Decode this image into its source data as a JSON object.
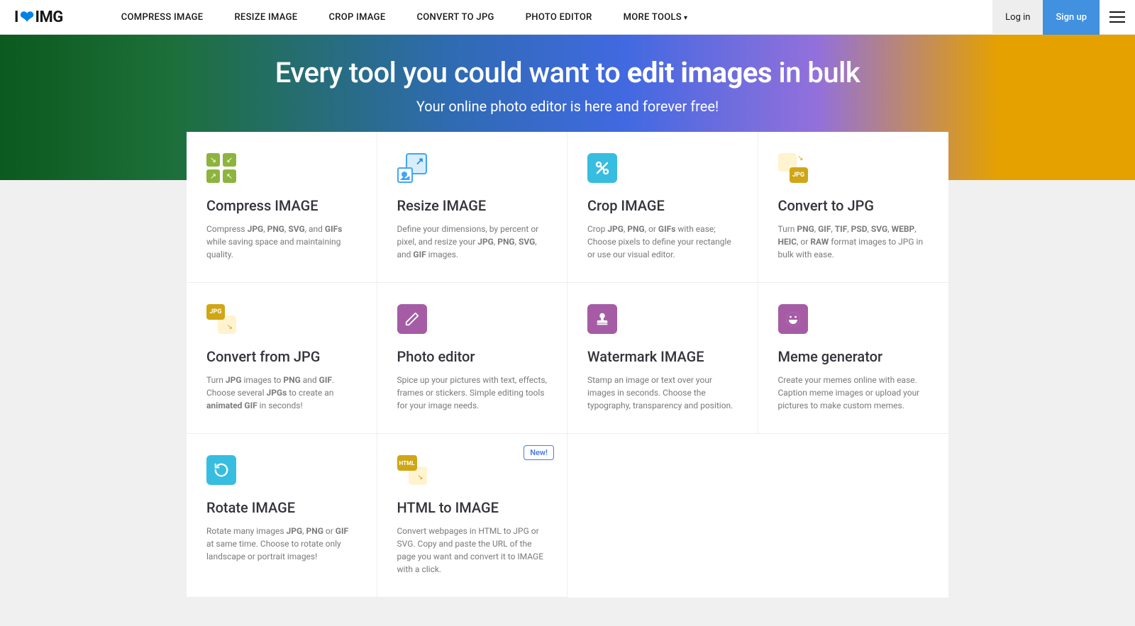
{
  "logo": {
    "prefix": "I",
    "suffix": "IMG"
  },
  "nav": {
    "items": [
      "COMPRESS IMAGE",
      "RESIZE IMAGE",
      "CROP IMAGE",
      "CONVERT TO JPG",
      "PHOTO EDITOR",
      "MORE TOOLS"
    ],
    "chevron": "▾"
  },
  "actions": {
    "login": "Log in",
    "signup": "Sign up"
  },
  "hero": {
    "title_pre": "Every tool you could want to ",
    "title_strong": "edit images",
    "title_post": " in bulk",
    "subtitle": "Your online photo editor is here and forever free!"
  },
  "badges": {
    "new": "New!"
  },
  "icons": {
    "jpg_label": "JPG",
    "html_label": "HTML"
  },
  "tools": [
    {
      "key": "compress",
      "title": "Compress IMAGE",
      "desc": "Compress <b>JPG</b>, <b>PNG</b>, <b>SVG</b>, and <b>GIFs</b> while saving space and maintaining quality."
    },
    {
      "key": "resize",
      "title": "Resize IMAGE",
      "desc": "Define your dimensions, by percent or pixel, and resize your <b>JPG</b>, <b>PNG</b>, <b>SVG</b>, and <b>GIF</b> images."
    },
    {
      "key": "crop",
      "title": "Crop IMAGE",
      "desc": "Crop <b>JPG</b>, <b>PNG</b>, or <b>GIFs</b> with ease; Choose pixels to define your rectangle or use our visual editor."
    },
    {
      "key": "tojpg",
      "title": "Convert to JPG",
      "desc": "Turn <b>PNG</b>, <b>GIF</b>, <b>TIF</b>, <b>PSD</b>, <b>SVG</b>, <b>WEBP</b>, <b>HEIC</b>, or <b>RAW</b> format images to JPG in bulk with ease."
    },
    {
      "key": "fromjpg",
      "title": "Convert from JPG",
      "desc": "Turn <b>JPG</b> images to <b>PNG</b> and <b>GIF</b>. Choose several <b>JPGs</b> to create an <b>animated GIF</b> in seconds!"
    },
    {
      "key": "editor",
      "title": "Photo editor",
      "desc": "Spice up your pictures with text, effects, frames or stickers. Simple editing tools for your image needs."
    },
    {
      "key": "watermark",
      "title": "Watermark IMAGE",
      "desc": "Stamp an image or text over your images in seconds. Choose the typography, transparency and position."
    },
    {
      "key": "meme",
      "title": "Meme generator",
      "desc": "Create your memes online with ease. Caption meme images or upload your pictures to make custom memes."
    },
    {
      "key": "rotate",
      "title": "Rotate IMAGE",
      "desc": "Rotate many images <b>JPG</b>, <b>PNG</b> or <b>GIF</b> at same time. Choose to rotate only landscape or portrait images!"
    },
    {
      "key": "html",
      "title": "HTML to IMAGE",
      "desc": "Convert webpages in HTML to JPG or SVG. Copy and paste the URL of the page you want and convert it to IMAGE with a click.",
      "badge": "new"
    }
  ],
  "colors": {
    "blue": "#37bde0",
    "purple": "#a55ca5",
    "yellow": "#d0a615",
    "green": "#8db43f"
  }
}
